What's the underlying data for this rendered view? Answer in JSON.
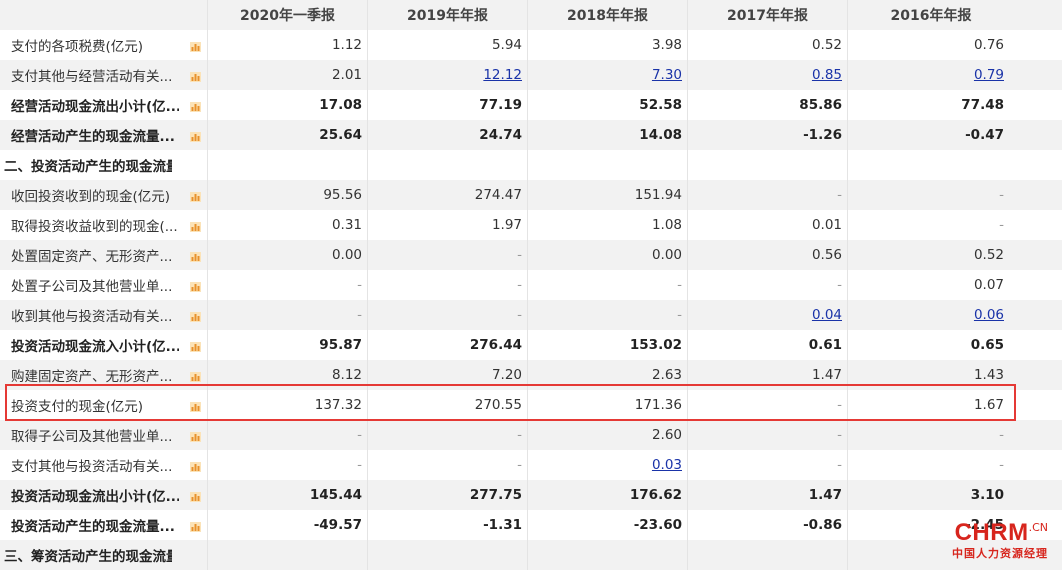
{
  "header": {
    "columns": [
      "2020年一季报",
      "2019年年报",
      "2018年年报",
      "2017年年报",
      "2016年年报"
    ]
  },
  "rows": [
    {
      "label": "支付的各项税费(亿元)",
      "values": [
        "1.12",
        "5.94",
        "3.98",
        "0.52",
        "0.76"
      ],
      "bold": false,
      "links": [
        false,
        false,
        false,
        false,
        false
      ],
      "section": false
    },
    {
      "label": "支付其他与经营活动有关...",
      "values": [
        "2.01",
        "12.12",
        "7.30",
        "0.85",
        "0.79"
      ],
      "bold": false,
      "links": [
        false,
        true,
        true,
        true,
        true
      ],
      "section": false
    },
    {
      "label": "经营活动现金流出小计(亿...",
      "values": [
        "17.08",
        "77.19",
        "52.58",
        "85.86",
        "77.48"
      ],
      "bold": true,
      "links": [
        false,
        false,
        false,
        false,
        false
      ],
      "section": false
    },
    {
      "label": "经营活动产生的现金流量...",
      "values": [
        "25.64",
        "24.74",
        "14.08",
        "-1.26",
        "-0.47"
      ],
      "bold": true,
      "links": [
        false,
        false,
        false,
        false,
        false
      ],
      "section": false
    },
    {
      "label": "二、投资活动产生的现金流量:",
      "values": [
        "",
        "",
        "",
        "",
        ""
      ],
      "bold": true,
      "links": [
        false,
        false,
        false,
        false,
        false
      ],
      "section": true
    },
    {
      "label": "收回投资收到的现金(亿元)",
      "values": [
        "95.56",
        "274.47",
        "151.94",
        "-",
        "-"
      ],
      "bold": false,
      "links": [
        false,
        false,
        false,
        false,
        false
      ],
      "section": false
    },
    {
      "label": "取得投资收益收到的现金(...",
      "values": [
        "0.31",
        "1.97",
        "1.08",
        "0.01",
        "-"
      ],
      "bold": false,
      "links": [
        false,
        false,
        false,
        false,
        false
      ],
      "section": false
    },
    {
      "label": "处置固定资产、无形资产...",
      "values": [
        "0.00",
        "-",
        "0.00",
        "0.56",
        "0.52"
      ],
      "bold": false,
      "links": [
        false,
        false,
        false,
        false,
        false
      ],
      "section": false
    },
    {
      "label": "处置子公司及其他营业单...",
      "values": [
        "-",
        "-",
        "-",
        "-",
        "0.07"
      ],
      "bold": false,
      "links": [
        false,
        false,
        false,
        false,
        false
      ],
      "section": false
    },
    {
      "label": "收到其他与投资活动有关...",
      "values": [
        "-",
        "-",
        "-",
        "0.04",
        "0.06"
      ],
      "bold": false,
      "links": [
        false,
        false,
        false,
        true,
        true
      ],
      "section": false
    },
    {
      "label": "投资活动现金流入小计(亿...",
      "values": [
        "95.87",
        "276.44",
        "153.02",
        "0.61",
        "0.65"
      ],
      "bold": true,
      "links": [
        false,
        false,
        false,
        false,
        false
      ],
      "section": false
    },
    {
      "label": "购建固定资产、无形资产...",
      "values": [
        "8.12",
        "7.20",
        "2.63",
        "1.47",
        "1.43"
      ],
      "bold": false,
      "links": [
        false,
        false,
        false,
        false,
        false
      ],
      "section": false
    },
    {
      "label": "投资支付的现金(亿元)",
      "values": [
        "137.32",
        "270.55",
        "171.36",
        "-",
        "1.67"
      ],
      "bold": false,
      "links": [
        false,
        false,
        false,
        false,
        false
      ],
      "section": false
    },
    {
      "label": "取得子公司及其他营业单...",
      "values": [
        "-",
        "-",
        "2.60",
        "-",
        "-"
      ],
      "bold": false,
      "links": [
        false,
        false,
        false,
        false,
        false
      ],
      "section": false
    },
    {
      "label": "支付其他与投资活动有关...",
      "values": [
        "-",
        "-",
        "0.03",
        "-",
        "-"
      ],
      "bold": false,
      "links": [
        false,
        false,
        true,
        false,
        false
      ],
      "section": false
    },
    {
      "label": "投资活动现金流出小计(亿...",
      "values": [
        "145.44",
        "277.75",
        "176.62",
        "1.47",
        "3.10"
      ],
      "bold": true,
      "links": [
        false,
        false,
        false,
        false,
        false
      ],
      "section": false
    },
    {
      "label": "投资活动产生的现金流量...",
      "values": [
        "-49.57",
        "-1.31",
        "-23.60",
        "-0.86",
        "-2.45"
      ],
      "bold": true,
      "links": [
        false,
        false,
        false,
        false,
        false
      ],
      "section": false
    },
    {
      "label": "三、筹资活动产生的现金流量:",
      "values": [
        "",
        "",
        "",
        "",
        ""
      ],
      "bold": true,
      "links": [
        false,
        false,
        false,
        false,
        false
      ],
      "section": true
    }
  ],
  "highlighted_row_label": "投资支付的现金(亿元)",
  "icons": {
    "row_chart": "bar-chart-icon"
  },
  "colors": {
    "link": "#1a33a8",
    "highlight_border": "#e53935",
    "watermark": "#d7251d",
    "alt_row": "#f2f2f2"
  },
  "watermark": {
    "brand": "CHRM",
    "suffix": ".CN",
    "subtitle": "中国人力资源经理"
  }
}
